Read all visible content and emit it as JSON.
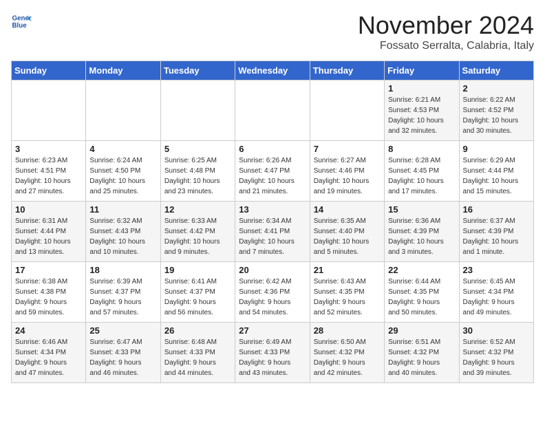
{
  "header": {
    "logo_line1": "General",
    "logo_line2": "Blue",
    "month": "November 2024",
    "location": "Fossato Serralta, Calabria, Italy"
  },
  "weekdays": [
    "Sunday",
    "Monday",
    "Tuesday",
    "Wednesday",
    "Thursday",
    "Friday",
    "Saturday"
  ],
  "weeks": [
    [
      {
        "day": "",
        "info": ""
      },
      {
        "day": "",
        "info": ""
      },
      {
        "day": "",
        "info": ""
      },
      {
        "day": "",
        "info": ""
      },
      {
        "day": "",
        "info": ""
      },
      {
        "day": "1",
        "info": "Sunrise: 6:21 AM\nSunset: 4:53 PM\nDaylight: 10 hours\nand 32 minutes."
      },
      {
        "day": "2",
        "info": "Sunrise: 6:22 AM\nSunset: 4:52 PM\nDaylight: 10 hours\nand 30 minutes."
      }
    ],
    [
      {
        "day": "3",
        "info": "Sunrise: 6:23 AM\nSunset: 4:51 PM\nDaylight: 10 hours\nand 27 minutes."
      },
      {
        "day": "4",
        "info": "Sunrise: 6:24 AM\nSunset: 4:50 PM\nDaylight: 10 hours\nand 25 minutes."
      },
      {
        "day": "5",
        "info": "Sunrise: 6:25 AM\nSunset: 4:48 PM\nDaylight: 10 hours\nand 23 minutes."
      },
      {
        "day": "6",
        "info": "Sunrise: 6:26 AM\nSunset: 4:47 PM\nDaylight: 10 hours\nand 21 minutes."
      },
      {
        "day": "7",
        "info": "Sunrise: 6:27 AM\nSunset: 4:46 PM\nDaylight: 10 hours\nand 19 minutes."
      },
      {
        "day": "8",
        "info": "Sunrise: 6:28 AM\nSunset: 4:45 PM\nDaylight: 10 hours\nand 17 minutes."
      },
      {
        "day": "9",
        "info": "Sunrise: 6:29 AM\nSunset: 4:44 PM\nDaylight: 10 hours\nand 15 minutes."
      }
    ],
    [
      {
        "day": "10",
        "info": "Sunrise: 6:31 AM\nSunset: 4:44 PM\nDaylight: 10 hours\nand 13 minutes."
      },
      {
        "day": "11",
        "info": "Sunrise: 6:32 AM\nSunset: 4:43 PM\nDaylight: 10 hours\nand 10 minutes."
      },
      {
        "day": "12",
        "info": "Sunrise: 6:33 AM\nSunset: 4:42 PM\nDaylight: 10 hours\nand 9 minutes."
      },
      {
        "day": "13",
        "info": "Sunrise: 6:34 AM\nSunset: 4:41 PM\nDaylight: 10 hours\nand 7 minutes."
      },
      {
        "day": "14",
        "info": "Sunrise: 6:35 AM\nSunset: 4:40 PM\nDaylight: 10 hours\nand 5 minutes."
      },
      {
        "day": "15",
        "info": "Sunrise: 6:36 AM\nSunset: 4:39 PM\nDaylight: 10 hours\nand 3 minutes."
      },
      {
        "day": "16",
        "info": "Sunrise: 6:37 AM\nSunset: 4:39 PM\nDaylight: 10 hours\nand 1 minute."
      }
    ],
    [
      {
        "day": "17",
        "info": "Sunrise: 6:38 AM\nSunset: 4:38 PM\nDaylight: 9 hours\nand 59 minutes."
      },
      {
        "day": "18",
        "info": "Sunrise: 6:39 AM\nSunset: 4:37 PM\nDaylight: 9 hours\nand 57 minutes."
      },
      {
        "day": "19",
        "info": "Sunrise: 6:41 AM\nSunset: 4:37 PM\nDaylight: 9 hours\nand 56 minutes."
      },
      {
        "day": "20",
        "info": "Sunrise: 6:42 AM\nSunset: 4:36 PM\nDaylight: 9 hours\nand 54 minutes."
      },
      {
        "day": "21",
        "info": "Sunrise: 6:43 AM\nSunset: 4:35 PM\nDaylight: 9 hours\nand 52 minutes."
      },
      {
        "day": "22",
        "info": "Sunrise: 6:44 AM\nSunset: 4:35 PM\nDaylight: 9 hours\nand 50 minutes."
      },
      {
        "day": "23",
        "info": "Sunrise: 6:45 AM\nSunset: 4:34 PM\nDaylight: 9 hours\nand 49 minutes."
      }
    ],
    [
      {
        "day": "24",
        "info": "Sunrise: 6:46 AM\nSunset: 4:34 PM\nDaylight: 9 hours\nand 47 minutes."
      },
      {
        "day": "25",
        "info": "Sunrise: 6:47 AM\nSunset: 4:33 PM\nDaylight: 9 hours\nand 46 minutes."
      },
      {
        "day": "26",
        "info": "Sunrise: 6:48 AM\nSunset: 4:33 PM\nDaylight: 9 hours\nand 44 minutes."
      },
      {
        "day": "27",
        "info": "Sunrise: 6:49 AM\nSunset: 4:33 PM\nDaylight: 9 hours\nand 43 minutes."
      },
      {
        "day": "28",
        "info": "Sunrise: 6:50 AM\nSunset: 4:32 PM\nDaylight: 9 hours\nand 42 minutes."
      },
      {
        "day": "29",
        "info": "Sunrise: 6:51 AM\nSunset: 4:32 PM\nDaylight: 9 hours\nand 40 minutes."
      },
      {
        "day": "30",
        "info": "Sunrise: 6:52 AM\nSunset: 4:32 PM\nDaylight: 9 hours\nand 39 minutes."
      }
    ]
  ]
}
